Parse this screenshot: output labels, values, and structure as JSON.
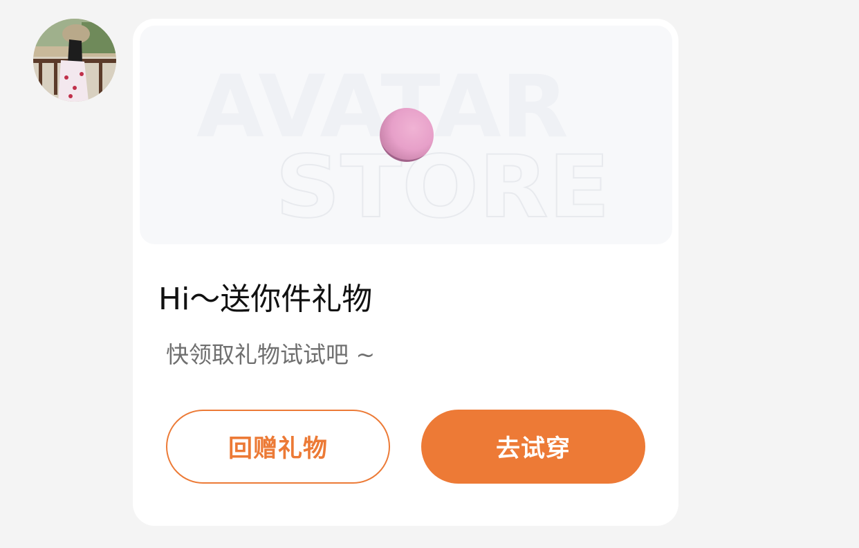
{
  "sender": {
    "avatar_label": "sender avatar"
  },
  "gift_card": {
    "banner": {
      "watermark_line1": "AVATAR",
      "watermark_line2": "STORE"
    },
    "title": "Hi～送你件礼物",
    "subtitle": "快领取礼物试试吧 ~",
    "buttons": {
      "return_gift": "回赠礼物",
      "try_on": "去试穿"
    }
  },
  "colors": {
    "accent": "#ed7a36",
    "page_bg": "#f4f4f4",
    "card_bg": "#ffffff",
    "banner_bg": "#f7f8fa",
    "ball": "#e7a0c9"
  }
}
